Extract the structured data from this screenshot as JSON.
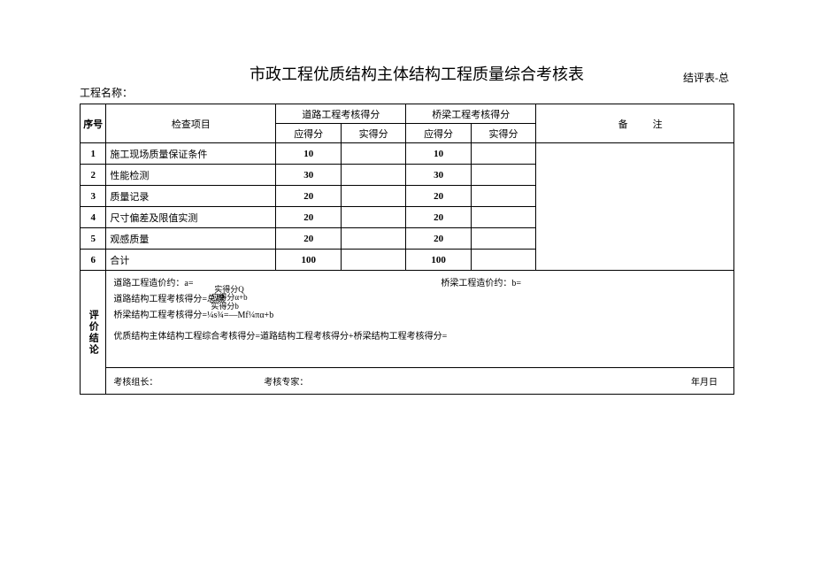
{
  "header": {
    "title": "市政工程优质结构主体结构工程质量综合考核表",
    "form_code": "结评表-总",
    "project_name_label": "工程名称："
  },
  "table_head": {
    "seq": "序号",
    "item": "检查项目",
    "road_group": "道路工程考核得分",
    "bridge_group": "桥梁工程考核得分",
    "remark": "备注",
    "due": "应得分",
    "got": "实得分"
  },
  "rows": [
    {
      "seq": "1",
      "item": "施工现场质量保证条件",
      "road_due": "10",
      "road_got": "",
      "bridge_due": "10",
      "bridge_got": ""
    },
    {
      "seq": "2",
      "item": "性能检测",
      "road_due": "30",
      "road_got": "",
      "bridge_due": "30",
      "bridge_got": ""
    },
    {
      "seq": "3",
      "item": "质量记录",
      "road_due": "20",
      "road_got": "",
      "bridge_due": "20",
      "bridge_got": ""
    },
    {
      "seq": "4",
      "item": "尺寸偏差及限值实测",
      "road_due": "20",
      "road_got": "",
      "bridge_due": "20",
      "bridge_got": ""
    },
    {
      "seq": "5",
      "item": "观感质量",
      "road_due": "20",
      "road_got": "",
      "bridge_due": "20",
      "bridge_got": ""
    },
    {
      "seq": "6",
      "item": "合计",
      "road_due": "100",
      "road_got": "",
      "bridge_due": "100",
      "bridge_got": ""
    }
  ],
  "conclusion": {
    "label": "评价结论",
    "line_a": "道路工程造价约：a=",
    "line_b": "桥梁工程造价约：b=",
    "road_formula_left": "道路结构工程考核得分=总腺",
    "road_frac_top": "实得分Q",
    "road_frac_bot": "应得分α+b",
    "bridge_formula_left": "桥梁结构工程考核得分=¼s¾=—Mf¼πα+b",
    "bridge_frac_top": "实得分b",
    "combined": "优质结构主体结构工程综合考核得分=道路结构工程考核得分+桥梁结构工程考核得分="
  },
  "sign": {
    "leader": "考核组长：",
    "expert": "考核专家：",
    "date": "年月日"
  }
}
